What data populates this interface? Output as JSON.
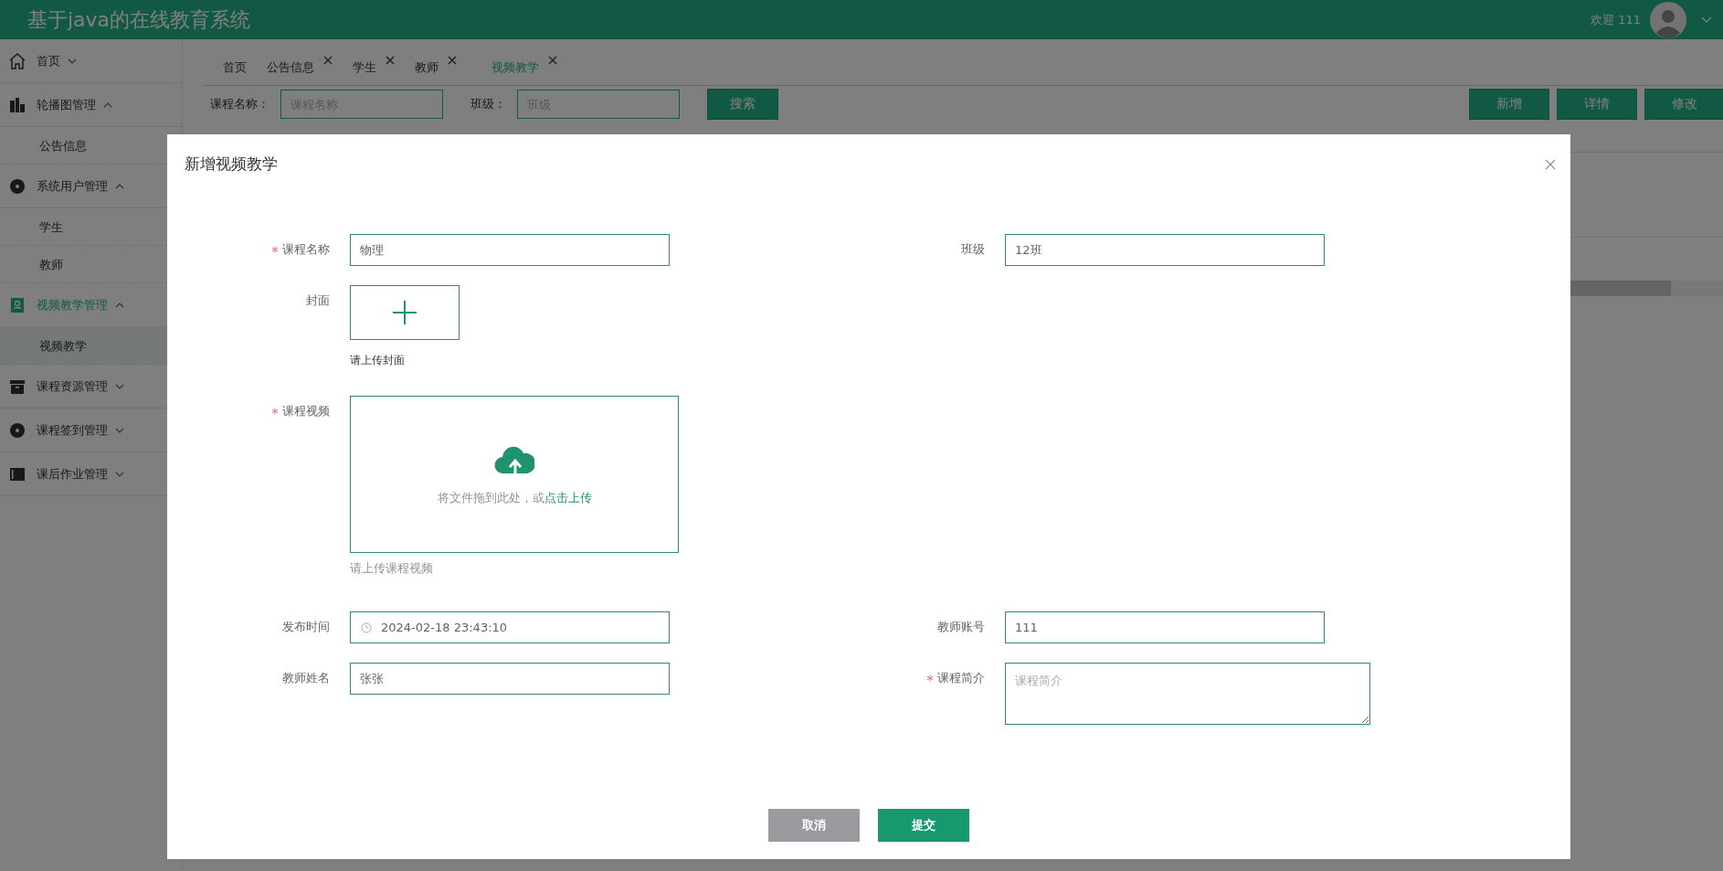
{
  "header": {
    "title": "基于java的在线教育系统",
    "greeting": "欢迎 111"
  },
  "sidebar": {
    "items": [
      {
        "label": "首页",
        "expanded": false,
        "selected": false
      },
      {
        "label": "轮播图管理",
        "expanded": true,
        "selected": false,
        "children": [
          {
            "label": "公告信息",
            "selected": false
          }
        ]
      },
      {
        "label": "系统用户管理",
        "expanded": true,
        "selected": false,
        "children": [
          {
            "label": "学生",
            "selected": false
          },
          {
            "label": "教师",
            "selected": false
          }
        ]
      },
      {
        "label": "视频教学管理",
        "expanded": true,
        "selected": true,
        "children": [
          {
            "label": "视频教学",
            "selected": true
          }
        ]
      },
      {
        "label": "课程资源管理",
        "expanded": false,
        "selected": false
      },
      {
        "label": "课程签到管理",
        "expanded": false,
        "selected": false
      },
      {
        "label": "课后作业管理",
        "expanded": false,
        "selected": false
      }
    ]
  },
  "tabs": [
    {
      "label": "首页",
      "closable": false,
      "selected": false
    },
    {
      "label": "公告信息",
      "closable": true,
      "selected": false
    },
    {
      "label": "学生",
      "closable": true,
      "selected": false
    },
    {
      "label": "教师",
      "closable": true,
      "selected": false
    },
    {
      "label": "视频教学",
      "closable": true,
      "selected": true
    }
  ],
  "search": {
    "fields": [
      {
        "label": "课程名称：",
        "placeholder": "课程名称"
      },
      {
        "label": "班级：",
        "placeholder": "班级"
      }
    ],
    "button": "搜索"
  },
  "actions": [
    "新增",
    "详情",
    "修改"
  ],
  "dialog": {
    "title": "新增视频教学",
    "rows": [
      [
        {
          "kind": "text",
          "label": "课程名称",
          "required": true,
          "value": "物理"
        },
        {
          "kind": "text",
          "label": "班级",
          "required": false,
          "value": "12班"
        }
      ],
      [
        {
          "kind": "image-upload",
          "label": "封面",
          "required": false,
          "hint": "请上传封面"
        }
      ],
      [
        {
          "kind": "video-upload",
          "label": "课程视频",
          "required": true,
          "prompt": "将文件拖到此处，或",
          "link": "点击上传",
          "hint": "请上传课程视频"
        }
      ],
      [
        {
          "kind": "datetime",
          "label": "发布时间",
          "required": false,
          "value": "2024-02-18 23:43:10"
        },
        {
          "kind": "text",
          "label": "教师账号",
          "required": false,
          "value": "111"
        }
      ],
      [
        {
          "kind": "text",
          "label": "教师姓名",
          "required": false,
          "value": "张张"
        },
        {
          "kind": "textarea",
          "label": "课程简介",
          "required": true,
          "placeholder": "课程简介"
        }
      ]
    ],
    "buttons": [
      {
        "label": "取消",
        "kind": "cancel"
      },
      {
        "label": "提交",
        "kind": "primary"
      }
    ]
  }
}
